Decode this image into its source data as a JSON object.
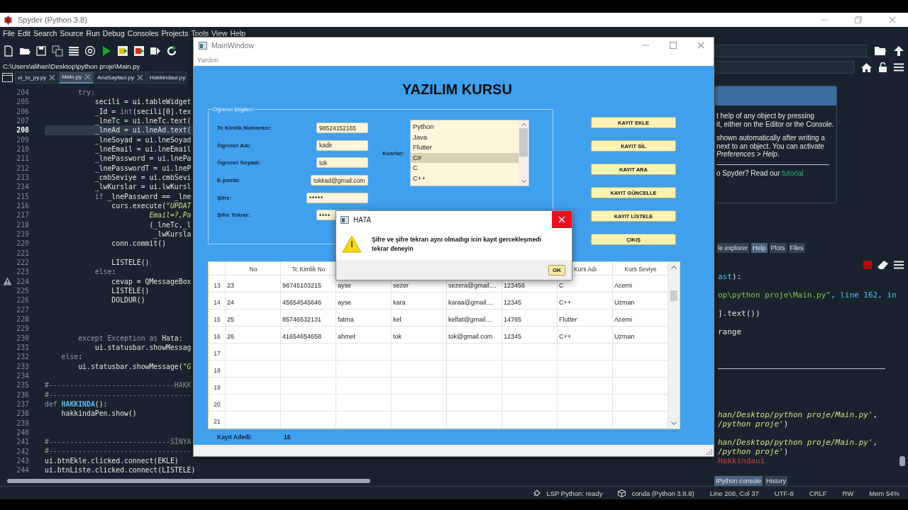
{
  "spyder": {
    "title": "Spyder (Python 3.8)",
    "menu": [
      "File",
      "Edit",
      "Search",
      "Source",
      "Run",
      "Debug",
      "Consoles",
      "Projects",
      "Tools",
      "View",
      "Help"
    ],
    "path": "C:\\Users\\alihan\\Desktop\\python proje\\Main.py",
    "file_tabs": [
      {
        "label": "ui_to_py.py",
        "selected": false,
        "closable": true
      },
      {
        "label": "Main.py",
        "selected": true,
        "closable": true
      },
      {
        "label": "AnaSayfaui.py",
        "selected": false,
        "closable": true
      },
      {
        "label": "Hakkindaui.py",
        "selected": false,
        "closable": false
      }
    ],
    "code": [
      {
        "number": "204",
        "tokens": [
          {
            "kind": "keyword",
            "text": "        try:"
          }
        ]
      },
      {
        "number": "205",
        "tokens": [
          {
            "kind": "plain",
            "text": "            secili = ui.tableWidget"
          }
        ]
      },
      {
        "number": "206",
        "tokens": [
          {
            "kind": "plain",
            "text": "            _Id = "
          },
          {
            "kind": "builtin",
            "text": "int"
          },
          {
            "kind": "plain",
            "text": "(secili[0].tex"
          }
        ]
      },
      {
        "number": "207",
        "tokens": [
          {
            "kind": "plain",
            "text": "            _lneTc = ui.lneTc.text("
          }
        ]
      },
      {
        "number": "208",
        "current": true,
        "tokens": [
          {
            "kind": "plain",
            "text": "            _lneAd = ui.lneAd.text("
          }
        ]
      },
      {
        "number": "209",
        "tokens": [
          {
            "kind": "plain",
            "text": "            _lneSoyad = ui.lneSoyad"
          }
        ]
      },
      {
        "number": "210",
        "tokens": [
          {
            "kind": "plain",
            "text": "            _lneEmail = ui.lneEmail"
          }
        ]
      },
      {
        "number": "211",
        "tokens": [
          {
            "kind": "plain",
            "text": "            _lnePassword = ui.lnePa"
          }
        ]
      },
      {
        "number": "212",
        "tokens": [
          {
            "kind": "plain",
            "text": "            _lnePasswordT = ui.lneP"
          }
        ]
      },
      {
        "number": "213",
        "tokens": [
          {
            "kind": "plain",
            "text": "            _cmbSeviye = ui.cmbSevi"
          }
        ]
      },
      {
        "number": "214",
        "tokens": [
          {
            "kind": "plain",
            "text": "            _lwKurslar = ui.lwKursl"
          }
        ]
      },
      {
        "number": "215",
        "tokens": [
          {
            "kind": "keyword",
            "text": "            if"
          },
          {
            "kind": "plain",
            "text": " _lnePassword == _lne"
          }
        ]
      },
      {
        "number": "216",
        "tokens": [
          {
            "kind": "plain",
            "text": "                curs.execute("
          },
          {
            "kind": "string",
            "text": "\"UPDAT"
          }
        ]
      },
      {
        "number": "217",
        "tokens": [
          {
            "kind": "string",
            "text": "                         Email=?,Pa"
          }
        ]
      },
      {
        "number": "218",
        "tokens": [
          {
            "kind": "plain",
            "text": "                         (_lneTc,_l"
          }
        ]
      },
      {
        "number": "219",
        "tokens": [
          {
            "kind": "plain",
            "text": "                          _lwKursla"
          }
        ]
      },
      {
        "number": "220",
        "tokens": [
          {
            "kind": "plain",
            "text": "                conn.commit()"
          }
        ]
      },
      {
        "number": "221"
      },
      {
        "number": "222",
        "tokens": [
          {
            "kind": "plain",
            "text": "                LISTELE()"
          }
        ]
      },
      {
        "number": "223",
        "tokens": [
          {
            "kind": "keyword",
            "text": "            else"
          },
          {
            "kind": "plain",
            "text": ":"
          }
        ]
      },
      {
        "number": "224",
        "warning": true,
        "tokens": [
          {
            "kind": "plain",
            "text": "                cevap = QMessageBox"
          }
        ]
      },
      {
        "number": "225",
        "tokens": [
          {
            "kind": "plain",
            "text": "                LISTELE()"
          }
        ]
      },
      {
        "number": "226",
        "tokens": [
          {
            "kind": "plain",
            "text": "                DOLDUR()"
          }
        ]
      },
      {
        "number": "227"
      },
      {
        "number": "228"
      },
      {
        "number": "229"
      },
      {
        "number": "230",
        "tokens": [
          {
            "kind": "keyword",
            "text": "        except Exception as"
          },
          {
            "kind": "plain",
            "text": " Hata:"
          }
        ]
      },
      {
        "number": "231",
        "tokens": [
          {
            "kind": "plain",
            "text": "            ui.statusbar.showMessag"
          }
        ]
      },
      {
        "number": "232",
        "tokens": [
          {
            "kind": "keyword",
            "text": "    else"
          },
          {
            "kind": "plain",
            "text": ":"
          }
        ]
      },
      {
        "number": "233",
        "tokens": [
          {
            "kind": "plain",
            "text": "        ui.statusbar.showMessage("
          },
          {
            "kind": "string",
            "text": "\"G"
          }
        ]
      },
      {
        "number": "234"
      },
      {
        "number": "235",
        "tokens": [
          {
            "kind": "comment",
            "text": "#------------------------------HAKK"
          }
        ]
      },
      {
        "number": "236",
        "tokens": [
          {
            "kind": "comment",
            "text": "#----------------------------------"
          }
        ]
      },
      {
        "number": "237",
        "tokens": [
          {
            "kind": "keyword",
            "text": "def "
          },
          {
            "kind": "function",
            "text": "HAKKINDA"
          },
          {
            "kind": "plain",
            "text": "():"
          }
        ]
      },
      {
        "number": "238",
        "tokens": [
          {
            "kind": "plain",
            "text": "    hakkindaPen.show()"
          }
        ]
      },
      {
        "number": "239"
      },
      {
        "number": "240"
      },
      {
        "number": "241",
        "tokens": [
          {
            "kind": "comment",
            "text": "#-----------------------------SİNYA"
          }
        ]
      },
      {
        "number": "242",
        "tokens": [
          {
            "kind": "comment",
            "text": "#----------------------------------"
          }
        ]
      },
      {
        "number": "243",
        "tokens": [
          {
            "kind": "plain",
            "text": "ui.btnEkle.clicked.connect(EKLE)"
          }
        ]
      },
      {
        "number": "244",
        "tokens": [
          {
            "kind": "plain",
            "text": "ui.btnListe.clicked.connect(LISTELE)"
          }
        ]
      }
    ],
    "help": {
      "paragraphs": [
        [
          "t help of any object by pressing",
          "it, either on the Editor or the Console."
        ],
        [
          "shown automatically after writing a",
          "next to an object. You can activate",
          "*Preferences > Help*."
        ]
      ],
      "prompt": "o Spyder? Read our",
      "link": "tutorial"
    },
    "pane_tabs": [
      {
        "label": "le explorer",
        "selected": false
      },
      {
        "label": "Help",
        "selected": true
      },
      {
        "label": "Plots",
        "selected": false
      },
      {
        "label": "Files",
        "selected": false
      }
    ],
    "console": [
      {
        "kind": "line",
        "tokens": [
          {
            "kind": "name",
            "text": "ast"
          },
          {
            "kind": "plain",
            "text": "):"
          }
        ]
      },
      {
        "kind": "blank"
      },
      {
        "kind": "line",
        "tokens": [
          {
            "kind": "string",
            "text": "op\\python proje\\Main.py\""
          },
          {
            "kind": "name",
            "text": ", line 162, in"
          }
        ]
      },
      {
        "kind": "blank"
      },
      {
        "kind": "line",
        "tokens": [
          {
            "kind": "plain",
            "text": "].text())"
          }
        ]
      },
      {
        "kind": "blank"
      },
      {
        "kind": "line",
        "tokens": [
          {
            "kind": "plain",
            "text": "range"
          }
        ]
      },
      {
        "kind": "blank"
      },
      {
        "kind": "blank"
      },
      {
        "kind": "blank"
      },
      {
        "kind": "rule"
      },
      {
        "kind": "blank"
      },
      {
        "kind": "blank"
      },
      {
        "kind": "blank"
      },
      {
        "kind": "blank"
      },
      {
        "kind": "line",
        "tokens": [
          {
            "kind": "path",
            "text": "han/Desktop/python proje/Main.py'"
          },
          {
            "kind": "plain",
            "text": ","
          }
        ]
      },
      {
        "kind": "line",
        "tokens": [
          {
            "kind": "path",
            "text": "/python proje'"
          },
          {
            "kind": "plain",
            "text": ")"
          }
        ]
      },
      {
        "kind": "blank"
      },
      {
        "kind": "line",
        "tokens": [
          {
            "kind": "path",
            "text": "han/Desktop/python proje/Main.py'"
          },
          {
            "kind": "plain",
            "text": ","
          }
        ]
      },
      {
        "kind": "line",
        "tokens": [
          {
            "kind": "path",
            "text": "/python proje'"
          },
          {
            "kind": "plain",
            "text": ")"
          }
        ]
      },
      {
        "kind": "line",
        "tokens": [
          {
            "kind": "error",
            "text": "Hakkindaui"
          }
        ]
      }
    ],
    "console_tabs": [
      {
        "label": "IPython console",
        "selected": true
      },
      {
        "label": "History",
        "selected": false
      }
    ],
    "status_bar": [
      {
        "kind": "lsp",
        "text": "LSP Python: ready"
      },
      {
        "kind": "conda",
        "text": "conda (Python 3.8.8)"
      },
      {
        "kind": "plain",
        "text": "Line 208, Col 37"
      },
      {
        "kind": "plain",
        "text": "UTF-8"
      },
      {
        "kind": "plain",
        "text": "CRLF"
      },
      {
        "kind": "plain",
        "text": "RW"
      },
      {
        "kind": "plain",
        "text": "Mem 54%"
      }
    ]
  },
  "main_window": {
    "title": "MainWindow",
    "menu": [
      "Yardım"
    ],
    "heading": "YAZILIM KURSU",
    "group_title": "Öğrenci Bilgileri",
    "fields": [
      {
        "label": "Tc Kimlik Numarası:",
        "value": "98524152165",
        "kind": "text"
      },
      {
        "label": "Ögrenci Adı:",
        "value": "kadir",
        "kind": "text"
      },
      {
        "label": "Ögrenci Soyadı:",
        "value": "tok",
        "kind": "text"
      },
      {
        "label": "E-posta:",
        "value": "tokkad@gmail.com",
        "kind": "wide"
      },
      {
        "label": "Şifre:",
        "value": "•••••",
        "kind": "password"
      },
      {
        "label": "Şifre Tekrar:",
        "value": "••••",
        "kind": "password-short"
      }
    ],
    "courses_label": "Kusrlar:",
    "courses": [
      {
        "label": "Python",
        "selected": false
      },
      {
        "label": "Java",
        "selected": false
      },
      {
        "label": "Flutter",
        "selected": false
      },
      {
        "label": "C#",
        "selected": true
      },
      {
        "label": "C",
        "selected": false
      },
      {
        "label": "C++",
        "selected": false
      }
    ],
    "buttons": [
      "KAYIT EKLE",
      "KAYIT SİL",
      "KAYIT ARA",
      "KAYIT GÜNCELLE",
      "KAYIT LİSTELE",
      "ÇIKIŞ"
    ],
    "table": {
      "columns": [
        "No",
        "Tc Kimlik No",
        null,
        null,
        null,
        null,
        "Kurs Adı",
        "Kurs Seviye"
      ],
      "rows": [
        {
          "header": "13",
          "cells": [
            "23",
            "98745103215",
            "ayse",
            "sezer",
            "sezera@gmail....",
            "123456",
            "C",
            "Acemi"
          ]
        },
        {
          "header": "14",
          "cells": [
            "24",
            "45654545646",
            "ayse",
            "kara",
            "karaa@gmail....",
            "12345",
            "C++",
            "Uzman"
          ]
        },
        {
          "header": "15",
          "cells": [
            "25",
            "85746532131",
            "fatma",
            "kel",
            "kelfat@gmail....",
            "14785",
            "Flutter",
            "Acemi"
          ]
        },
        {
          "header": "16",
          "cells": [
            "26",
            "41654654658",
            "ahmet",
            "tok",
            "tok@gmail.com",
            "12345",
            "C++",
            "Uzman"
          ]
        },
        {
          "header": "17"
        },
        {
          "header": "18"
        },
        {
          "header": "19"
        },
        {
          "header": "20"
        },
        {
          "header": "21"
        }
      ]
    },
    "count_label": "Kayıt Adedi:",
    "count": "16"
  },
  "dialog": {
    "title": "HATA",
    "message": "Şifre ve şifre tekrarı aynı olmadıgı icin kayıt gercekleşmedi tekrar deneyin",
    "buttons": [
      "OK"
    ]
  }
}
